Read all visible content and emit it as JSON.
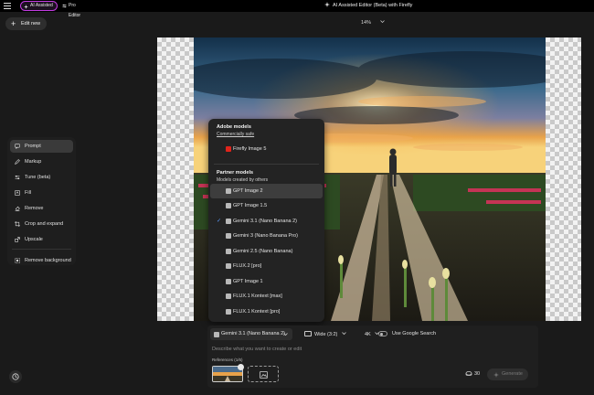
{
  "topbar": {
    "tabs": [
      {
        "label": "AI Assisted",
        "active": true
      },
      {
        "label": "Pro Editor",
        "active": false
      }
    ],
    "window_title": "AI Assisted Editor (Beta) with Firefly"
  },
  "toolbar": {
    "edit_new_label": "Edit new",
    "zoom": "14%"
  },
  "tools": [
    {
      "label": "Prompt",
      "icon": "prompt-icon",
      "active": true
    },
    {
      "label": "Markup",
      "icon": "markup-icon",
      "active": false
    },
    {
      "label": "Tune (beta)",
      "icon": "tune-icon",
      "active": false
    },
    {
      "label": "Fill",
      "icon": "fill-icon",
      "active": false
    },
    {
      "label": "Remove",
      "icon": "remove-icon",
      "active": false
    },
    {
      "label": "Crop and expand",
      "icon": "crop-icon",
      "active": false
    },
    {
      "label": "Upscale",
      "icon": "upscale-icon",
      "active": false
    },
    {
      "label": "Remove background",
      "icon": "remove-background-icon",
      "active": false
    }
  ],
  "model_menu": {
    "adobe_header": "Adobe models",
    "adobe_subtitle": "Commercially safe",
    "adobe_items": [
      {
        "label": "Firefly Image 5"
      }
    ],
    "partner_header": "Partner models",
    "partner_subtitle": "Models created by others",
    "partner_items": [
      {
        "label": "GPT Image 2",
        "hover": true
      },
      {
        "label": "GPT Image 1.5"
      },
      {
        "label": "Gemini 3.1 (Nano Banana 2)",
        "selected": true
      },
      {
        "label": "Gemini 3 (Nano Banana Pro)"
      },
      {
        "label": "Gemini 2.5 (Nano Banana)"
      },
      {
        "label": "FLUX.2 [pro]"
      },
      {
        "label": "GPT Image 1"
      },
      {
        "label": "FLUX.1 Kontext [max]"
      },
      {
        "label": "FLUX.1 Kontext [pro]"
      }
    ]
  },
  "prompt_panel": {
    "selected_model": "Gemini 3.1 (Nano Banana 2)",
    "aspect_ratio": "Wide (3:2)",
    "resolution": "4K",
    "google_search_label": "Use Google Search",
    "google_search_enabled": false,
    "prompt_placeholder": "Describe what you want to create or edit",
    "references_label": "References (1/6)",
    "credits": "30",
    "generate_label": "Generate"
  },
  "colors": {
    "accent_tab_border": "#c23be0",
    "firefly_red": "#e0241b",
    "check_blue": "#5e9cff"
  }
}
